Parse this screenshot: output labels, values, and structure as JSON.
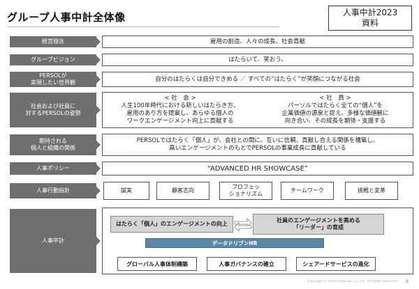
{
  "title": "グループ人事中計全体像",
  "badge": {
    "line1": "人事中計2023",
    "line2": "資料"
  },
  "rows": {
    "philosophy": {
      "label": "経営理念",
      "content": "雇用の創造、人々の成長、社会貢献"
    },
    "vision": {
      "label": "グループビジョン",
      "content": "はたらいて、笑おう。"
    },
    "world": {
      "label": "PERSOLが\n実現したい世界観",
      "content": "自分のはたらくは自分できめる ／ すべての“はたらく”が笑顔につながる社会"
    },
    "stance": {
      "label": "社会および社員に\n対するPERSOLの姿勢",
      "society": {
        "heading": "< 社　会 >",
        "text": "人生100年時代における新しいはたらき方、\n雇用のあり方を提案し、あらゆる個人の\nワークエンゲージメント向上に貢献する"
      },
      "employee": {
        "heading": "< 社　員 >",
        "text": "パーソルではたらく全ての“個人”を\n企業価値の源泉と捉え、多様な価値観に\n向き合い、その成長を期待・支援する"
      }
    },
    "expected": {
      "label": "期待される\n個人と組織の関係",
      "content": "PERSOLではたらく「個人」が、会社との間に、互いに信頼、貢献し合える関係を構築し、\n高いエンゲージメントのもとでPERSOLの事業成長に貢献している"
    },
    "policy": {
      "label": "人事ポリシー",
      "content": "“ADVANCED HR SHOWCASE”"
    },
    "guideline": {
      "label": "人事行動指針",
      "items": [
        "誠実",
        "顧客志向",
        "プロフェッ\nショナリズム",
        "チームワーク",
        "挑戦と変革"
      ]
    },
    "plan": {
      "label": "人事中計",
      "left_bar": "はたらく「個人」のエンゲージメントの向上",
      "right_bar": "社員のエンゲージメントを高める\n「リーダー」の育成",
      "data_driven": "データドリブンHR",
      "pills": [
        "グローバル人事体制構築",
        "人事ガバナンスの確立",
        "シェアードサービスの進化"
      ]
    }
  },
  "footer": "Copyright © Persol Holdings Co., Ltd. All Rights Reserved.",
  "page_number": "9",
  "colors": {
    "label_bg": "#6f6f6f",
    "data_driven_bg": "#5c88a8",
    "bar_bg": "#d5d5d5"
  }
}
